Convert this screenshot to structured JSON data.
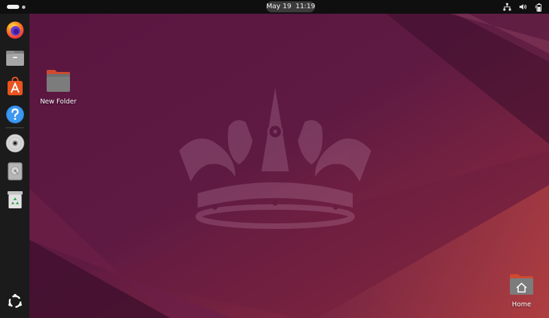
{
  "topbar": {
    "date": "May 19",
    "time": "11:19",
    "tray_icons": [
      "network-icon",
      "volume-icon",
      "battery-icon"
    ]
  },
  "dock": {
    "items": [
      {
        "name": "firefox-icon",
        "label": "Firefox"
      },
      {
        "name": "files-icon",
        "label": "Files"
      },
      {
        "name": "app-center-icon",
        "label": "App Center"
      },
      {
        "name": "help-icon",
        "label": "Help"
      },
      {
        "name": "optical-disc-icon",
        "label": "Disc"
      },
      {
        "name": "drive-icon",
        "label": "Drive"
      },
      {
        "name": "trash-icon",
        "label": "Trash"
      },
      {
        "name": "show-apps-icon",
        "label": "Show Apps"
      }
    ]
  },
  "desktop": {
    "new_folder_label": "New Folder",
    "home_label": "Home"
  },
  "colors": {
    "wallpaper_base": "#5b1640",
    "wallpaper_accent": "#c2463e",
    "panel": "#0f0f0f",
    "dock": "#1b1b1b"
  }
}
